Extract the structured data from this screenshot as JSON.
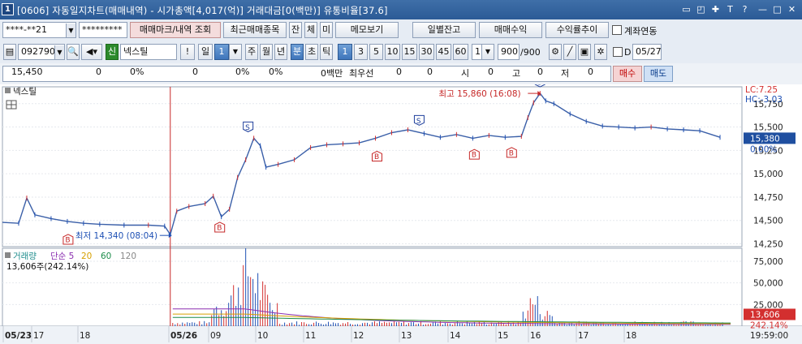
{
  "window": {
    "number": "1",
    "title": "[0606] 자동일지차트(매매내역) - 시가총액[4,017(억)] 거래대금[0(백만)] 유통비율[37.6]"
  },
  "toolbar1": {
    "account": "****-**21",
    "password": "*********",
    "trade_mark_btn": "매매마크/내역 조회",
    "recent_btn": "최근매매종목",
    "jan_btn": "잔",
    "che_btn": "체",
    "mi_btn": "미",
    "memo_btn": "메모보기",
    "daily_btn": "일별잔고",
    "profit_btn": "매매수익",
    "trend_btn": "수익률추이",
    "link_label": "계좌연동"
  },
  "toolbar2": {
    "code": "092790",
    "badge": "신",
    "stock_name": "넥스틸",
    "excl": "!",
    "period_day": "일",
    "period_value": "1",
    "week": "주",
    "month": "월",
    "year": "년",
    "minute": "분",
    "second": "초",
    "tick": "틱",
    "intervals": [
      "1",
      "3",
      "5",
      "10",
      "15",
      "30",
      "45",
      "60"
    ],
    "custom_interval": "1",
    "count": "900",
    "count_max": "/900",
    "d_label": "D",
    "date": "05/27"
  },
  "quote": {
    "price": "15,450",
    "v1": "0",
    "p1": "0%",
    "v2": "0",
    "p2": "0%",
    "p3": "0%",
    "amount": "0백만",
    "priority": "최우선",
    "bid": "0",
    "ask": "0",
    "open_label": "시",
    "open": "0",
    "high_label": "고",
    "high": "0",
    "low_label": "저",
    "low": "0",
    "buy_btn": "매수",
    "sell_btn": "매도"
  },
  "chart_data": {
    "type": "line",
    "title": "넥스틸",
    "limit_high": "LC:7.25",
    "limit_low": "HC:-3.03",
    "current_price": "15,380",
    "current_pct": "0.00%",
    "high_annotation": "최고 15,860 (16:08)",
    "low_annotation": "최저 14,340 (08:04)",
    "y_ticks": [
      "15,750",
      "15,500",
      "15,250",
      "15,000",
      "14,750",
      "14,500",
      "14,250"
    ],
    "ylim": [
      14220,
      15800
    ],
    "x_ticks": [
      {
        "label": "05/23",
        "bold": true
      },
      {
        "label": "17",
        "bold": false
      },
      {
        "label": "18",
        "bold": false
      },
      {
        "label": "05/26",
        "bold": true
      },
      {
        "label": "09",
        "bold": false
      },
      {
        "label": "10",
        "bold": false
      },
      {
        "label": "11",
        "bold": false
      },
      {
        "label": "12",
        "bold": false
      },
      {
        "label": "13",
        "bold": false
      },
      {
        "label": "14",
        "bold": false
      },
      {
        "label": "15",
        "bold": false
      },
      {
        "label": "16",
        "bold": false
      },
      {
        "label": "17",
        "bold": false
      },
      {
        "label": "18",
        "bold": false
      }
    ],
    "time_label": "19:59:00",
    "price_series": [
      [
        0,
        14480
      ],
      [
        20,
        14470
      ],
      [
        30,
        14740
      ],
      [
        40,
        14560
      ],
      [
        60,
        14520
      ],
      [
        80,
        14490
      ],
      [
        100,
        14470
      ],
      [
        120,
        14460
      ],
      [
        150,
        14450
      ],
      [
        180,
        14450
      ],
      [
        200,
        14440
      ],
      [
        207,
        14350
      ],
      [
        215,
        14600
      ],
      [
        230,
        14650
      ],
      [
        250,
        14680
      ],
      [
        260,
        14760
      ],
      [
        270,
        14540
      ],
      [
        280,
        14620
      ],
      [
        290,
        14960
      ],
      [
        300,
        15150
      ],
      [
        310,
        15380
      ],
      [
        318,
        15300
      ],
      [
        325,
        15070
      ],
      [
        340,
        15100
      ],
      [
        360,
        15150
      ],
      [
        380,
        15280
      ],
      [
        400,
        15310
      ],
      [
        420,
        15320
      ],
      [
        440,
        15330
      ],
      [
        460,
        15380
      ],
      [
        480,
        15440
      ],
      [
        500,
        15470
      ],
      [
        520,
        15430
      ],
      [
        540,
        15390
      ],
      [
        560,
        15420
      ],
      [
        580,
        15380
      ],
      [
        600,
        15410
      ],
      [
        620,
        15390
      ],
      [
        640,
        15400
      ],
      [
        648,
        15600
      ],
      [
        655,
        15760
      ],
      [
        663,
        15860
      ],
      [
        670,
        15780
      ],
      [
        680,
        15750
      ],
      [
        700,
        15640
      ],
      [
        720,
        15560
      ],
      [
        740,
        15510
      ],
      [
        760,
        15500
      ],
      [
        780,
        15490
      ],
      [
        800,
        15500
      ],
      [
        820,
        15480
      ],
      [
        840,
        15470
      ],
      [
        860,
        15460
      ],
      [
        885,
        15390
      ]
    ],
    "trade_marks": [
      {
        "x": 81,
        "price": 14420,
        "type": "B"
      },
      {
        "x": 268,
        "price": 14550,
        "type": "B"
      },
      {
        "x": 303,
        "price": 15380,
        "type": "S"
      },
      {
        "x": 462,
        "price": 15310,
        "type": "B"
      },
      {
        "x": 514,
        "price": 15450,
        "type": "S"
      },
      {
        "x": 582,
        "price": 15330,
        "type": "B"
      },
      {
        "x": 628,
        "price": 15350,
        "type": "B"
      },
      {
        "x": 663,
        "price": 15860,
        "type": "S"
      }
    ],
    "volume": {
      "title": "거래량",
      "legend": [
        {
          "name": "단순 5",
          "color": "#8b2fb0"
        },
        {
          "name": "20",
          "color": "#d6a000"
        },
        {
          "name": "60",
          "color": "#1c8c4a"
        },
        {
          "name": "120",
          "color": "#888888"
        }
      ],
      "current": "13,606주(242.14%)",
      "y_ticks": [
        "75,000",
        "50,000",
        "25,000"
      ],
      "ylim": [
        0,
        90000
      ],
      "current_value": "13,606",
      "current_pct": "242.14%"
    }
  }
}
